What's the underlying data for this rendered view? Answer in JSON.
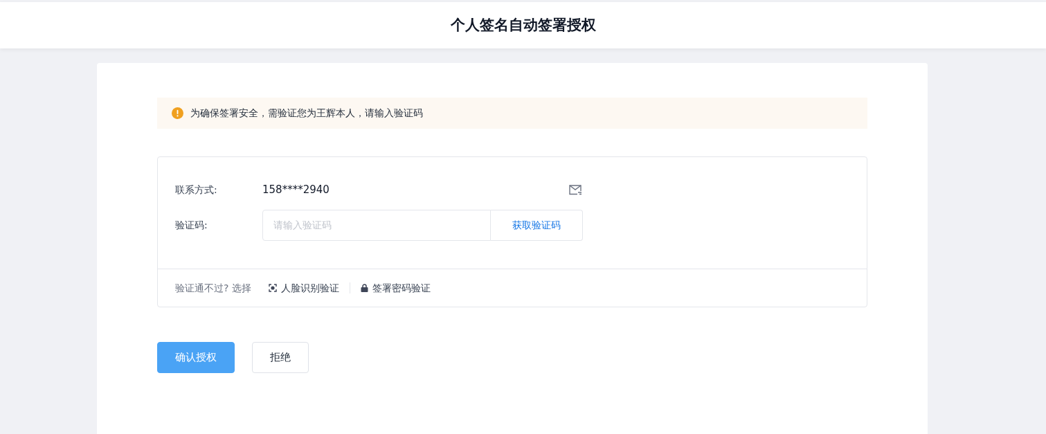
{
  "header": {
    "title": "个人签名自动签署授权"
  },
  "notice": {
    "text": "为确保签署安全，需验证您为王辉本人，请输入验证码"
  },
  "form": {
    "contact_label": "联系方式:",
    "contact_value": "158****2940",
    "code_label": "验证码:",
    "code_placeholder": "请输入验证码",
    "get_code_button": "获取验证码"
  },
  "alternatives": {
    "prompt": "验证通不过? 选择",
    "options": [
      {
        "kind": "face",
        "label": "人脸识别验证"
      },
      {
        "kind": "password",
        "label": "签署密码验证"
      }
    ]
  },
  "buttons": [
    {
      "kind": "primary",
      "label": "确认授权"
    },
    {
      "kind": "secondary",
      "label": "拒绝"
    }
  ]
}
